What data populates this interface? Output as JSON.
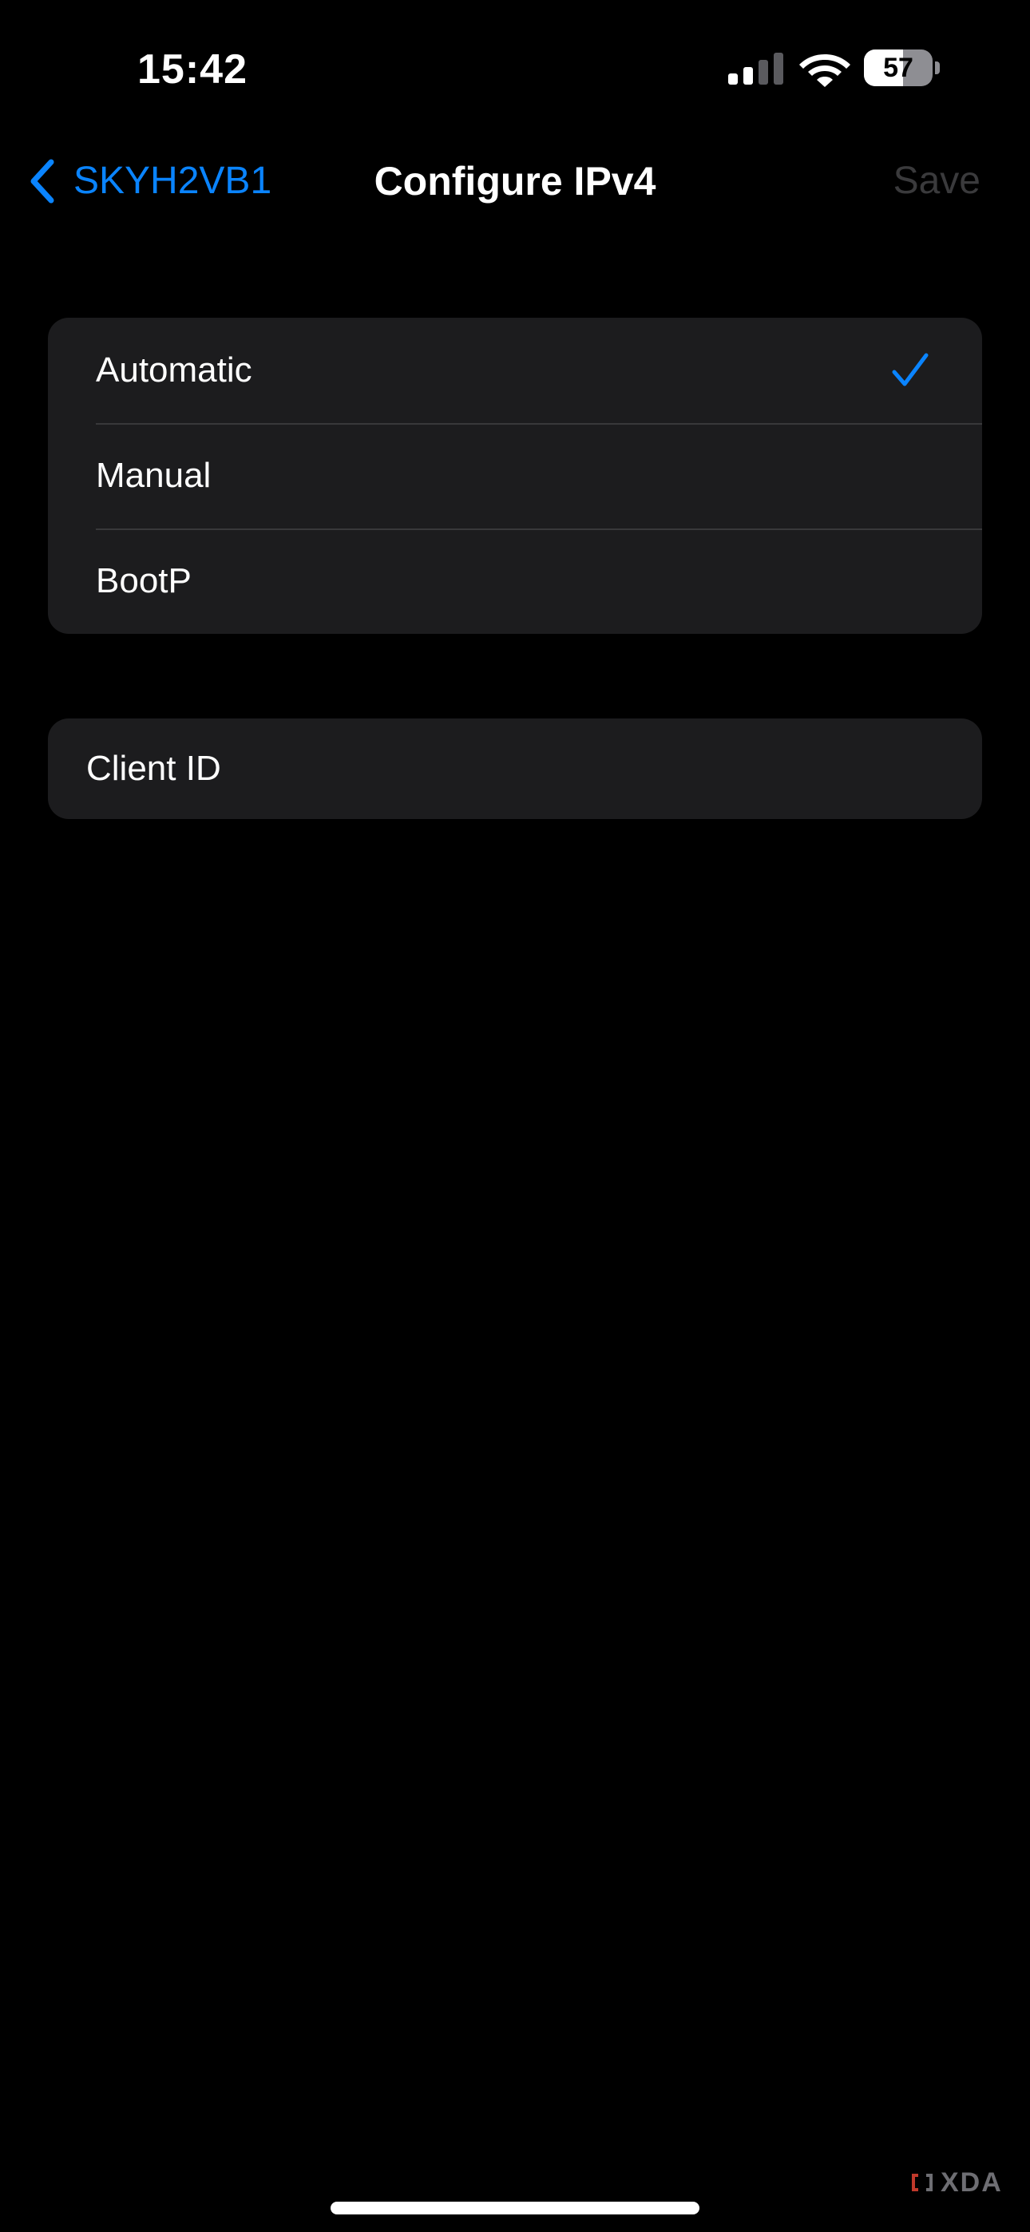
{
  "status_bar": {
    "time": "15:42",
    "battery_percent": "57",
    "battery_level": 57,
    "signal_bars_active": 2,
    "signal_bars_total": 4,
    "icons": [
      "signal-icon",
      "wifi-icon",
      "battery-icon"
    ]
  },
  "nav": {
    "back_label": "SKYH2VB1",
    "back_icon": "chevron-left-icon",
    "title": "Configure IPv4",
    "save_label": "Save"
  },
  "options": {
    "items": [
      {
        "label": "Automatic",
        "selected": true
      },
      {
        "label": "Manual",
        "selected": false
      },
      {
        "label": "BootP",
        "selected": false
      }
    ],
    "check_icon": "checkmark-icon"
  },
  "client_id": {
    "placeholder": "Client ID",
    "value": ""
  },
  "watermark": {
    "text": "XDA"
  },
  "colors": {
    "background": "#000000",
    "cell": "#1c1c1e",
    "separator": "#38383a",
    "accent": "#0a84ff",
    "disabled": "#3a3a3c",
    "text": "#ffffff"
  }
}
